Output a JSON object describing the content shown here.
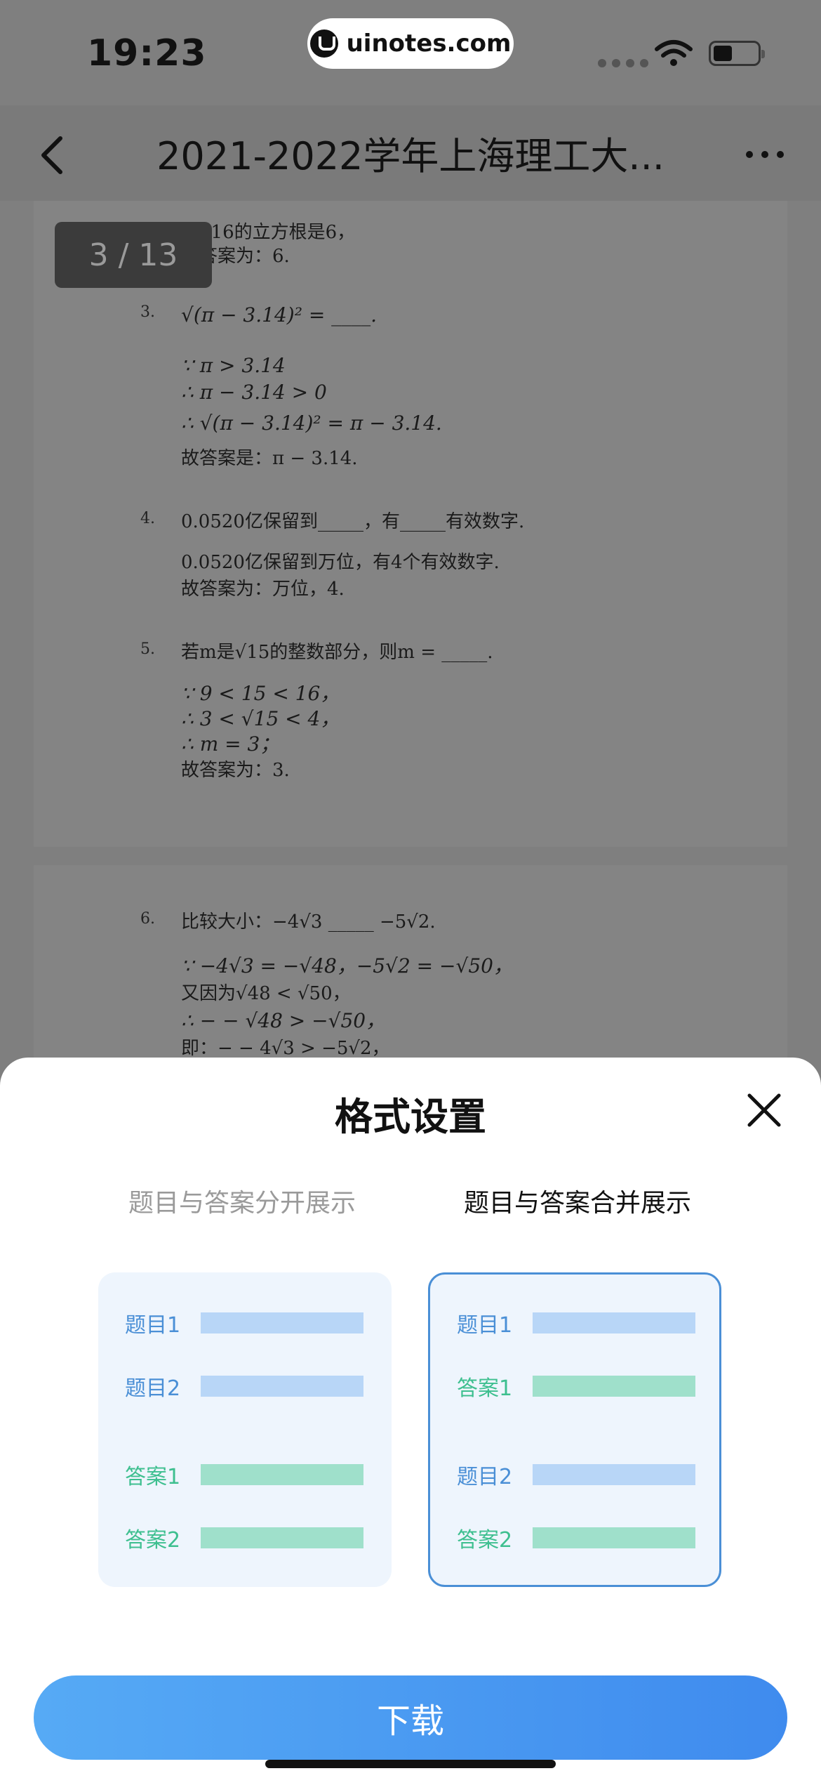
{
  "status_bar": {
    "time": "19:23",
    "url": "uinotes.com"
  },
  "header": {
    "title": "2021-2022学年上海理工大...",
    "page_counter": "3 / 13"
  },
  "document": {
    "lines_a": [
      "故216的立方根是6，",
      "故答案为：6."
    ],
    "q3": {
      "num": "3.",
      "question": "√(π − 3.14)² = ____.",
      "steps": [
        "∵ π > 3.14",
        "∴ π − 3.14 > 0",
        "∴ √(π − 3.14)² = π − 3.14.",
        "故答案是：π − 3.14."
      ]
    },
    "q4": {
      "num": "4.",
      "question": "0.0520亿保留到_____，有_____有效数字.",
      "steps": [
        "0.0520亿保留到万位，有4个有效数字.",
        "故答案为：万位，4."
      ]
    },
    "q5": {
      "num": "5.",
      "question": "若m是√15的整数部分，则m = _____.",
      "steps": [
        "∵ 9 < 15 < 16，",
        "∴ 3 < √15 < 4，",
        "∴ m = 3；",
        "故答案为：3."
      ]
    },
    "q6": {
      "num": "6.",
      "question": "比较大小：−4√3 _____ −5√2.",
      "steps": [
        "∵ −4√3 = −√48，−5√2 = −√50，",
        "又因为√48 < √50，",
        "∴ − − √48 > −√50，",
        "即：− − 4√3 > −5√2，"
      ]
    }
  },
  "sheet": {
    "title": "格式设置",
    "tab_separate": "题目与答案分开展示",
    "tab_merged": "题目与答案合并展示",
    "card_separate": [
      "题目1",
      "题目2",
      "答案1",
      "答案2"
    ],
    "card_merged": [
      "题目1",
      "答案1",
      "题目2",
      "答案2"
    ],
    "download_label": "下载"
  },
  "colors": {
    "accent_blue": "#4a8fd6",
    "question_bar": "#b8d6f7",
    "answer_bar": "#9fe0cb",
    "answer_text": "#3dbf8f"
  }
}
